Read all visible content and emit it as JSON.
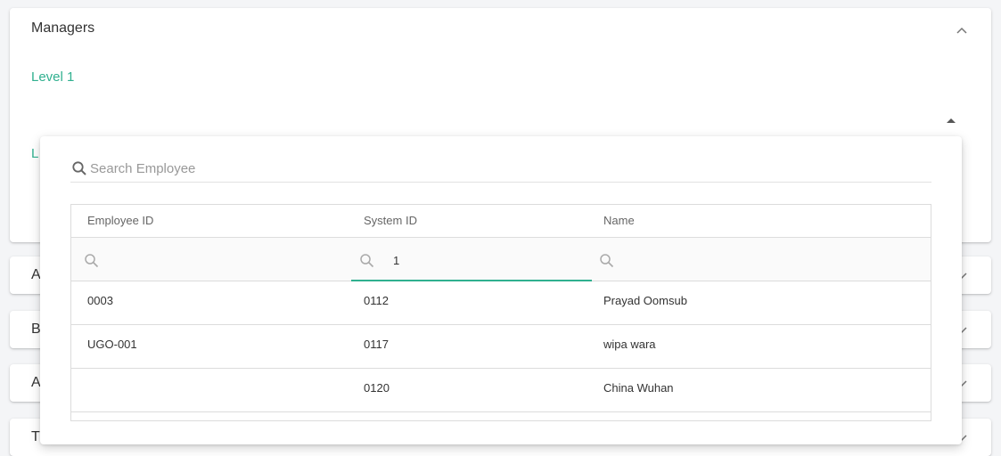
{
  "panels": {
    "main": {
      "title": "Managers",
      "level1_label": "Level 1",
      "level2_label": "L"
    },
    "collapsed": [
      {
        "title": "A"
      },
      {
        "title": "B"
      },
      {
        "title": "A"
      },
      {
        "title": "T"
      }
    ]
  },
  "dropdown": {
    "search_placeholder": "Search Employee",
    "search_value": "",
    "columns": [
      "Employee ID",
      "System ID",
      "Name"
    ],
    "filters": [
      {
        "value": ""
      },
      {
        "value": "1"
      },
      {
        "value": ""
      }
    ],
    "rows": [
      {
        "employee_id": "0003",
        "system_id": "0112",
        "name": "Prayad Oomsub"
      },
      {
        "employee_id": "UGO-001",
        "system_id": "0117",
        "name": "wipa wara"
      },
      {
        "employee_id": "",
        "system_id": "0120",
        "name": "China Wuhan"
      }
    ]
  },
  "colors": {
    "accent": "#30b08f",
    "border": "#dcdcdc",
    "text": "#333333",
    "muted": "#999999"
  },
  "icons": {
    "search": "search-icon",
    "collapse": "chevron-up-icon",
    "expand": "chevron-down-icon",
    "select_open": "caret-up-icon"
  }
}
